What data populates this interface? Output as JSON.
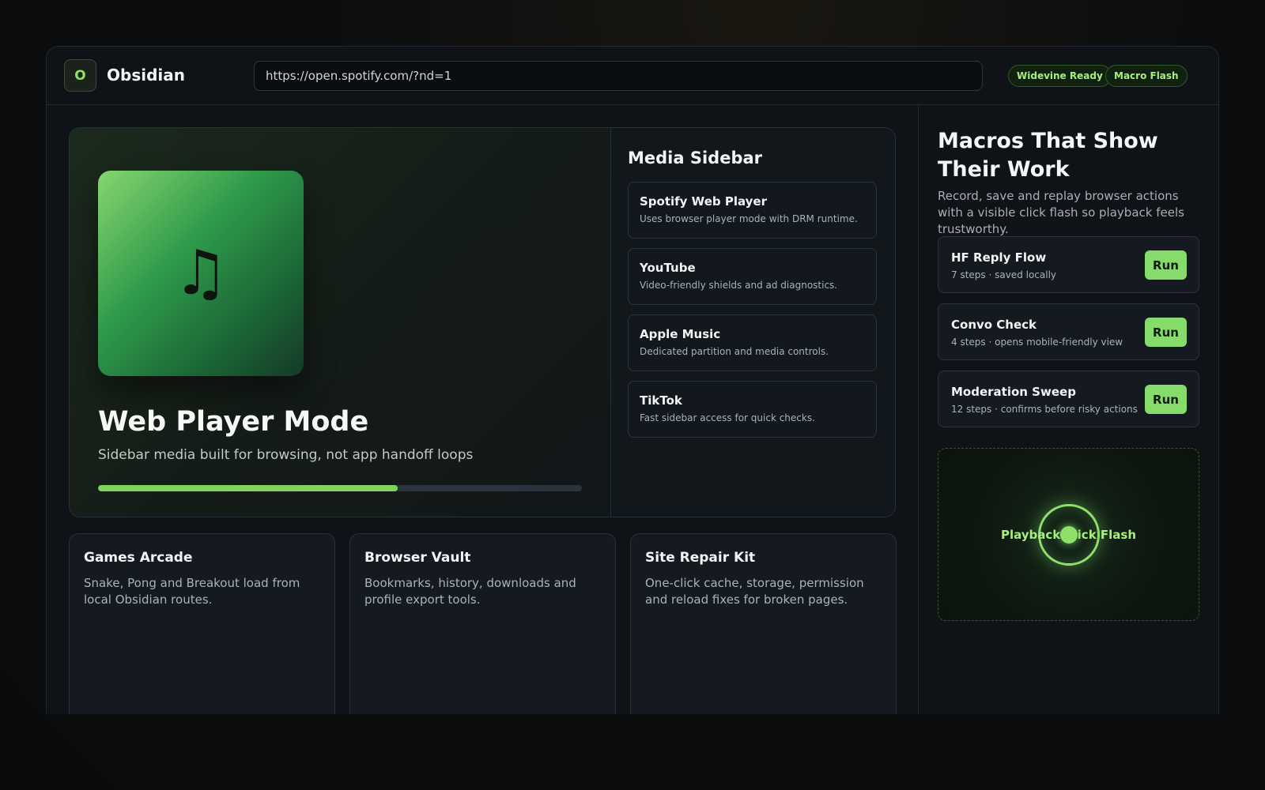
{
  "app": {
    "logo_letter": "O",
    "name": "Obsidian"
  },
  "address_bar": {
    "url": "https://open.spotify.com/?nd=1"
  },
  "status_pills": [
    "Widevine Ready",
    "Macro Flash"
  ],
  "hero": {
    "title": "Web Player Mode",
    "subtitle": "Sidebar media built for browsing, not app handoff loops",
    "album_icon": "music-note-icon",
    "progress_fraction": 0.62
  },
  "media_sidebar": {
    "title": "Media Sidebar",
    "items": [
      {
        "title": "Spotify Web Player",
        "desc": "Uses browser player mode with DRM runtime."
      },
      {
        "title": "YouTube",
        "desc": "Video-friendly shields and ad diagnostics."
      },
      {
        "title": "Apple Music",
        "desc": "Dedicated partition and media controls."
      },
      {
        "title": "TikTok",
        "desc": "Fast sidebar access for quick checks."
      }
    ]
  },
  "tools": [
    {
      "title": "Games Arcade",
      "desc": "Snake, Pong and Breakout load from local Obsidian routes."
    },
    {
      "title": "Browser Vault",
      "desc": "Bookmarks, history, downloads and profile export tools."
    },
    {
      "title": "Site Repair Kit",
      "desc": "One-click cache, storage, permission and reload fixes for broken pages."
    }
  ],
  "macros": {
    "title": "Macros That Show Their Work",
    "desc": "Record, save and replay browser actions with a visible click flash so playback feels trustworthy.",
    "items": [
      {
        "title": "HF Reply Flow",
        "meta": "7 steps · saved locally",
        "button": "Run"
      },
      {
        "title": "Convo Check",
        "meta": "4 steps · opens mobile-friendly view",
        "button": "Run"
      },
      {
        "title": "Moderation Sweep",
        "meta": "12 steps · confirms before risky actions",
        "button": "Run"
      }
    ],
    "flash_label": "Playback Click Flash"
  },
  "colors": {
    "accent": "#86dc6a",
    "background": "#0f1317"
  }
}
